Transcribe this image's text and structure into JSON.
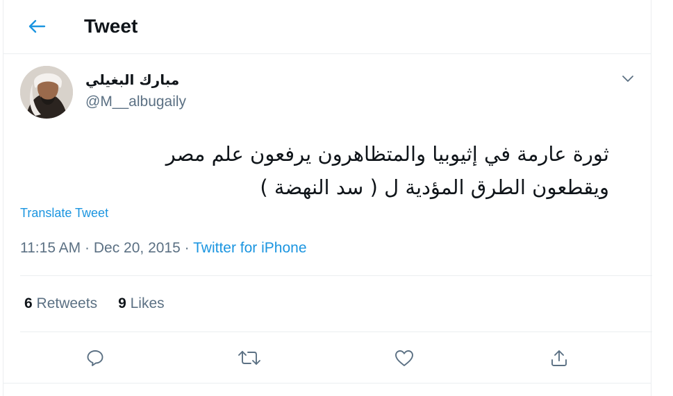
{
  "header": {
    "title": "Tweet",
    "back_icon": "arrow-left-icon"
  },
  "tweet": {
    "author_name": "مبارك البغيلي",
    "author_handle": "@M__albugaily",
    "text_line1": "ثورة عارمة في إثيوبيا والمتظاهرون يرفعون علم مصر",
    "text_line2": "ويقطعون الطرق المؤدية ل ( سد النهضة )",
    "translate_label": "Translate Tweet",
    "time": "11:15 AM",
    "date": "Dec 20, 2015",
    "separator": "·",
    "source": "Twitter for iPhone"
  },
  "stats": {
    "retweets_count": "6",
    "retweets_label": "Retweets",
    "likes_count": "9",
    "likes_label": "Likes"
  },
  "actions": [
    "reply-icon",
    "retweet-icon",
    "like-icon",
    "share-icon"
  ],
  "colors": {
    "accent": "#1b95e0",
    "secondary_text": "#5b7083",
    "divider": "#ebeef0",
    "primary_text": "#0f1419"
  }
}
